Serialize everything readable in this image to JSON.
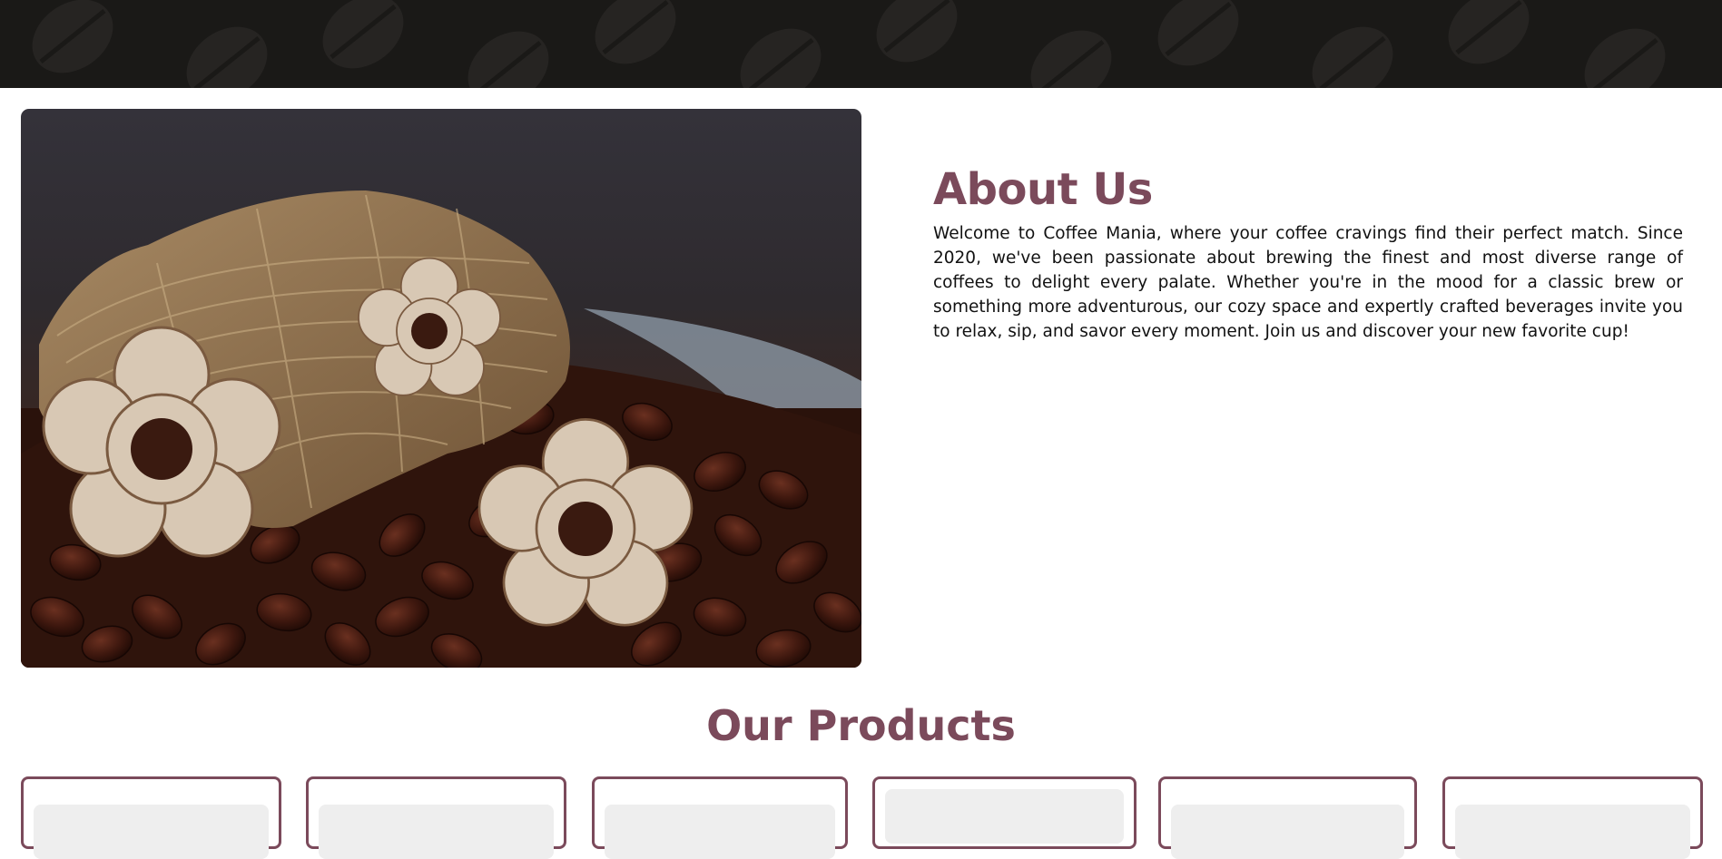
{
  "header": {
    "pattern_icon": "coffee-bean-pattern",
    "background": "#1a1917"
  },
  "hero": {
    "image_icon": "coffee-beans-with-wooden-flowers-photo"
  },
  "about": {
    "title": "About Us",
    "text": "Welcome to Coffee Mania, where your coffee cravings find their perfect match. Since 2020, we've been passionate about brewing the finest and most diverse range of coffees to delight every palate. Whether you're in the mood for a classic brew or something more adventurous, our cozy space and expertly crafted beverages invite you to relax, sip, and savor every moment. Join us and discover your new favorite cup!"
  },
  "products": {
    "title": "Our Products",
    "card_count_visible": 6
  },
  "colors": {
    "accent": "#7b4a5b",
    "card_placeholder": "#eeeeee"
  }
}
